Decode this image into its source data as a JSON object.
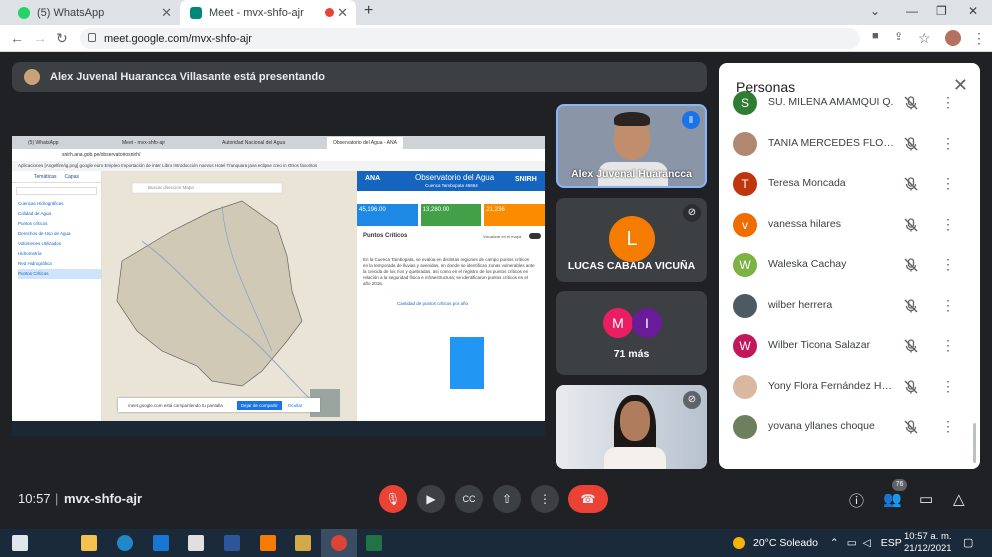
{
  "browser": {
    "tabs": [
      {
        "title": "(5) WhatsApp",
        "favicon_color": "#25d366"
      },
      {
        "title": "Meet - mvx-shfo-ajr",
        "favicon_color": "#00897b"
      }
    ],
    "url": "meet.google.com/mvx-shfo-ajr"
  },
  "meet": {
    "presenting_banner": "Alex Juvenal Huarancca Villasante está presentando",
    "tiles": {
      "presenter_name": "Alex Juvenal Huarancca",
      "lucas_initial": "L",
      "lucas_name": "LUCAS CABADA VICUÑA",
      "group_initials": [
        "M",
        "I"
      ],
      "more_label": "71 más"
    },
    "shared_screen": {
      "inner_tabs": [
        "(5) WhatsApp",
        "Meet - mvx-shfo-ajr",
        "Autoridad Nacional del Agua",
        "Observatorio del Agua - ANA"
      ],
      "inner_url": "snirh.ana.gob.pe/observatoriosnirh/",
      "bookmarks": "Aplicaciones   [Angelfire/ig.png]   google euro   Empleo   Importación de inter   Libro Introducción   nuevos   Hotel Tranquara   java eclipse creo in   Otros favoritos",
      "sidebar_tabs": [
        "Temáticas",
        "Capas"
      ],
      "sidebar_items": [
        "Cuencas Hidrográficas",
        "Calidad de Agua",
        "Puntos críticos",
        "Derechos de Uso de Agua",
        "Volúmenes Utilizados",
        "Hidrometría",
        "Red Hidrográfica",
        "Puntos Críticos"
      ],
      "map_search_placeholder": "Buscar dirección Mapa",
      "dash_brand": "ANA",
      "dash_title": "Observatorio del Agua",
      "dash_subtitle": "Cuenca Tambopata 46664",
      "dash_brand2": "SNIRH",
      "dash_kpis": [
        {
          "value": "45,196.00",
          "color": "#1e88e5"
        },
        {
          "value": "13,280.00",
          "color": "#43a047"
        },
        {
          "value": "21,236",
          "color": "#fb8c00"
        }
      ],
      "dash_section": "Puntos Críticos",
      "dash_toggle_label": "Visualizar en el mapa",
      "dash_paragraph": "En la Cuenca Tambopata, se evalúa en distintas regiones de campo puntos críticos en la temporada de lluvias y avenidas, en donde se identifican zonas vulnerables ante la crecida de los ríos y quebradas, así como en el registro de los puntos críticos en relación a la seguridad física e infraestructura; se identificaron puntos críticos en el año 2016.",
      "dash_chart_title": "Cantidad de puntos críticos por año",
      "share_notice": "meet.google.com está compartiendo tu pantalla",
      "share_stop": "Dejar de compartir",
      "share_hide": "Ocultar"
    }
  },
  "people_panel": {
    "title": "Personas",
    "participants": [
      {
        "name": "SU. MILENA AMAMQUI Q.",
        "initial": "S",
        "color": "#2e7d32"
      },
      {
        "name": "TANIA MERCEDES FLORES",
        "initial": "",
        "color": "#b08870"
      },
      {
        "name": "Teresa Moncada",
        "initial": "T",
        "color": "#bf360c"
      },
      {
        "name": "vanessa hilares",
        "initial": "v",
        "color": "#ef6c00"
      },
      {
        "name": "Waleska Cachay",
        "initial": "W",
        "color": "#7cb342"
      },
      {
        "name": "wilber herrera",
        "initial": "",
        "color": "#4e5a62"
      },
      {
        "name": "Wilber Ticona Salazar",
        "initial": "W",
        "color": "#c2185b"
      },
      {
        "name": "Yony Flora Fernández Her...",
        "initial": "",
        "color": "#d9b8a0"
      },
      {
        "name": "yovana yllanes choque",
        "initial": "",
        "color": "#6d7f5e"
      }
    ]
  },
  "controls": {
    "time": "10:57",
    "separator": "|",
    "meeting_code": "mvx-shfo-ajr",
    "participant_count": "76"
  },
  "taskbar": {
    "weather": "20°C  Soleado",
    "language": "ESP",
    "time": "10:57 a. m.",
    "date": "21/12/2021"
  }
}
